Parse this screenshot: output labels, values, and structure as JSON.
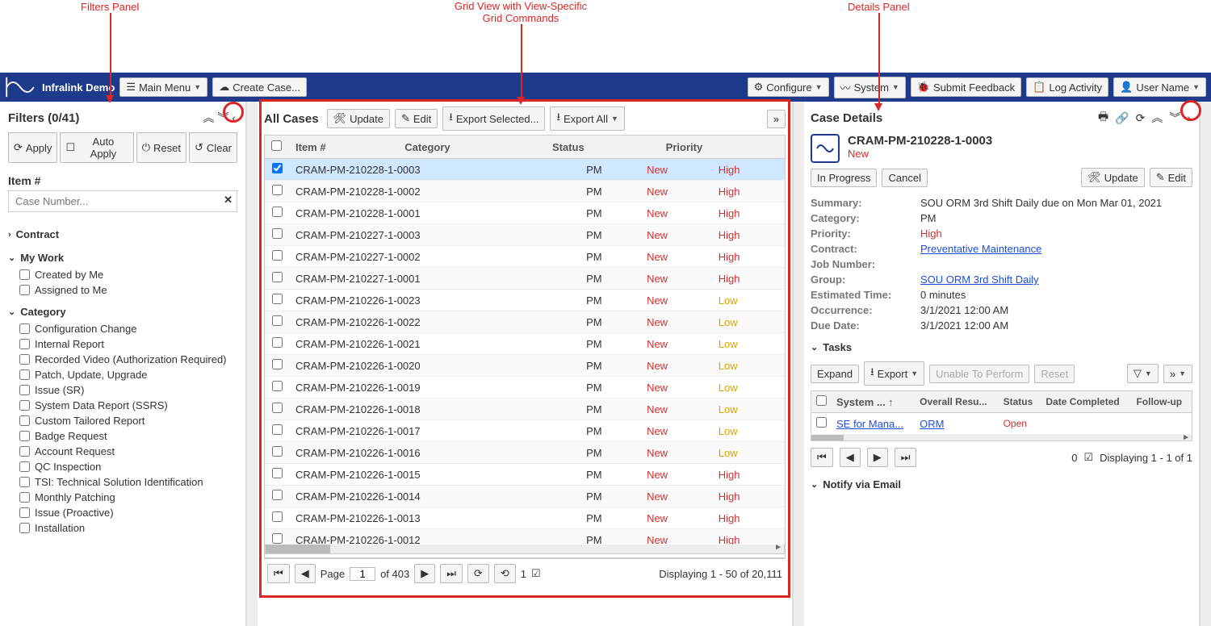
{
  "annotations": {
    "filters": "Filters Panel",
    "grid": "Grid View with View-Specific\nGrid Commands",
    "details": "Details Panel"
  },
  "topbar": {
    "app_name": "Infralink Demo",
    "main_menu": "Main Menu",
    "create_case": "Create Case...",
    "configure": "Configure",
    "system": "System",
    "submit_feedback": "Submit Feedback",
    "log_activity": "Log Activity",
    "user_name": "User Name"
  },
  "filters": {
    "title": "Filters (0/41)",
    "apply": "Apply",
    "auto_apply": "Auto Apply",
    "reset": "Reset",
    "clear": "Clear",
    "item_num_label": "Item #",
    "item_num_placeholder": "Case Number...",
    "contract_label": "Contract",
    "my_work_label": "My Work",
    "my_work_items": [
      "Created by Me",
      "Assigned to Me"
    ],
    "category_label": "Category",
    "category_items": [
      "Configuration Change",
      "Internal Report",
      "Recorded Video (Authorization Required)",
      "Patch, Update, Upgrade",
      "Issue (SR)",
      "System Data Report (SSRS)",
      "Custom Tailored Report",
      "Badge Request",
      "Account Request",
      "QC Inspection",
      "TSI: Technical Solution Identification",
      "Monthly Patching",
      "Issue (Proactive)",
      "Installation"
    ]
  },
  "grid": {
    "title": "All Cases",
    "update": "Update",
    "edit": "Edit",
    "export_selected": "Export Selected...",
    "export_all": "Export All",
    "columns": {
      "item": "Item #",
      "category": "Category",
      "status": "Status",
      "priority": "Priority"
    },
    "rows": [
      {
        "item": "CRAM-PM-210228-1-0003",
        "category": "PM",
        "status": "New",
        "priority": "High",
        "checked": true
      },
      {
        "item": "CRAM-PM-210228-1-0002",
        "category": "PM",
        "status": "New",
        "priority": "High"
      },
      {
        "item": "CRAM-PM-210228-1-0001",
        "category": "PM",
        "status": "New",
        "priority": "High"
      },
      {
        "item": "CRAM-PM-210227-1-0003",
        "category": "PM",
        "status": "New",
        "priority": "High"
      },
      {
        "item": "CRAM-PM-210227-1-0002",
        "category": "PM",
        "status": "New",
        "priority": "High"
      },
      {
        "item": "CRAM-PM-210227-1-0001",
        "category": "PM",
        "status": "New",
        "priority": "High"
      },
      {
        "item": "CRAM-PM-210226-1-0023",
        "category": "PM",
        "status": "New",
        "priority": "Low"
      },
      {
        "item": "CRAM-PM-210226-1-0022",
        "category": "PM",
        "status": "New",
        "priority": "Low"
      },
      {
        "item": "CRAM-PM-210226-1-0021",
        "category": "PM",
        "status": "New",
        "priority": "Low"
      },
      {
        "item": "CRAM-PM-210226-1-0020",
        "category": "PM",
        "status": "New",
        "priority": "Low"
      },
      {
        "item": "CRAM-PM-210226-1-0019",
        "category": "PM",
        "status": "New",
        "priority": "Low"
      },
      {
        "item": "CRAM-PM-210226-1-0018",
        "category": "PM",
        "status": "New",
        "priority": "Low"
      },
      {
        "item": "CRAM-PM-210226-1-0017",
        "category": "PM",
        "status": "New",
        "priority": "Low"
      },
      {
        "item": "CRAM-PM-210226-1-0016",
        "category": "PM",
        "status": "New",
        "priority": "Low"
      },
      {
        "item": "CRAM-PM-210226-1-0015",
        "category": "PM",
        "status": "New",
        "priority": "High"
      },
      {
        "item": "CRAM-PM-210226-1-0014",
        "category": "PM",
        "status": "New",
        "priority": "High"
      },
      {
        "item": "CRAM-PM-210226-1-0013",
        "category": "PM",
        "status": "New",
        "priority": "High"
      },
      {
        "item": "CRAM-PM-210226-1-0012",
        "category": "PM",
        "status": "New",
        "priority": "High"
      }
    ],
    "paging": {
      "page_label": "Page",
      "page": "1",
      "of": "of 403",
      "displaying": "Displaying 1 - 50 of 20,111",
      "one": "1"
    }
  },
  "details": {
    "title": "Case Details",
    "case_id": "CRAM-PM-210228-1-0003",
    "case_status": "New",
    "in_progress": "In Progress",
    "cancel": "Cancel",
    "update": "Update",
    "edit": "Edit",
    "fields": {
      "summary_k": "Summary:",
      "summary_v": "SOU ORM 3rd Shift Daily due on Mon Mar 01, 2021",
      "category_k": "Category:",
      "category_v": "PM",
      "priority_k": "Priority:",
      "priority_v": "High",
      "contract_k": "Contract:",
      "contract_v": "Preventative Maintenance",
      "jobnum_k": "Job Number:",
      "jobnum_v": "",
      "group_k": "Group:",
      "group_v": "SOU ORM 3rd Shift Daily",
      "esttime_k": "Estimated Time:",
      "esttime_v": "0 minutes",
      "occur_k": "Occurrence:",
      "occur_v": "3/1/2021 12:00 AM",
      "due_k": "Due Date:",
      "due_v": "3/1/2021 12:00 AM"
    },
    "tasks": {
      "label": "Tasks",
      "expand": "Expand",
      "export": "Export",
      "unable": "Unable To Perform",
      "reset": "Reset",
      "columns": {
        "system": "System ...",
        "overall": "Overall Resu...",
        "status": "Status",
        "date": "Date Completed",
        "follow": "Follow-up"
      },
      "rows": [
        {
          "system": "SE for Mana...",
          "overall": "ORM",
          "status": "Open",
          "date": "",
          "follow": ""
        }
      ],
      "displaying": "Displaying 1 - 1 of 1",
      "zero": "0"
    },
    "notify_label": "Notify via Email"
  }
}
